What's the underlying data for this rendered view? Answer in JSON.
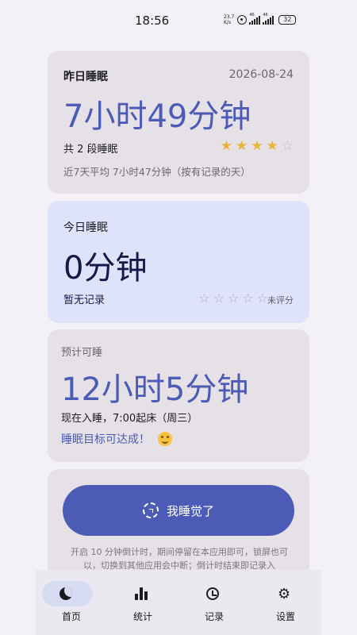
{
  "status_bar": {
    "time": "18:56",
    "net_speed_value": "23.7",
    "net_speed_unit": "K/s",
    "sim1_label": "46",
    "sim2_label": "46",
    "battery": "32"
  },
  "yesterday": {
    "title": "昨日睡眠",
    "date": "2026-08-24",
    "duration": "7小时49分钟",
    "segments": "共 2 段睡眠",
    "rating": 4,
    "rating_max": 5,
    "average": "近7天平均 7小时47分钟（按有记录的天）"
  },
  "today": {
    "title": "今日睡眠",
    "duration": "0分钟",
    "record_status": "暂无记录",
    "unrated_label": "未评分"
  },
  "estimate": {
    "title": "预计可睡",
    "duration": "12小时5分钟",
    "bedtime_text": "现在入睡，7:00起床（周三）",
    "goal_text": "睡眠目标可达成！"
  },
  "action": {
    "button_label": "我睡觉了",
    "hint": "开启 10 分钟倒计时，期间停留在本应用即可，锁屏也可以，切换到其他应用会中断；倒计时结束即记录入"
  },
  "nav": {
    "home": "首页",
    "stats": "统计",
    "records": "记录",
    "settings": "设置"
  },
  "colors": {
    "accent": "#4b5bb6",
    "star": "#e8b43c",
    "today_card": "#dfe2fb",
    "card": "#e5e1e6"
  }
}
